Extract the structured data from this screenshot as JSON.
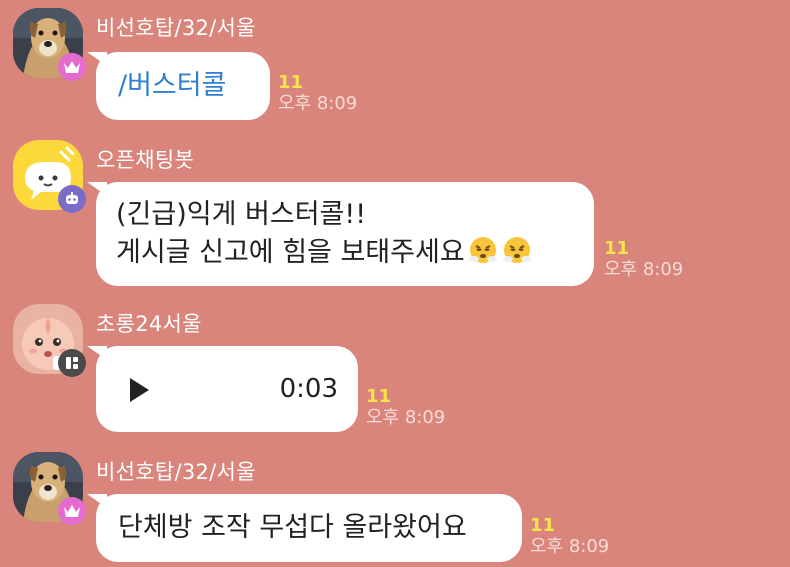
{
  "background_color": "#d9857c",
  "messages": [
    {
      "sender": "비선호탑/32/서울",
      "avatar_icon": "dog-photo-avatar",
      "badge_icon": "crown-icon",
      "text": "/버스터콜",
      "read_count": "11",
      "time": "오후 8:09"
    },
    {
      "sender": "오픈채팅봇",
      "avatar_icon": "chatbot-avatar",
      "badge_icon": "robot-icon",
      "line1": "(긴급)익게 버스터콜!!",
      "line2": "게시글 신고에 힘을 보태주세요",
      "emoji_icon": "angry-steam-face-emoji",
      "read_count": "11",
      "time": "오후 8:09"
    },
    {
      "sender": "초롱24서울",
      "avatar_icon": "peach-character-avatar",
      "badge_icon": "manager-icon",
      "duration": "0:03",
      "play_icon": "play-icon",
      "read_count": "11",
      "time": "오후 8:09"
    },
    {
      "sender": "비선호탑/32/서울",
      "avatar_icon": "dog-photo-avatar",
      "badge_icon": "crown-icon",
      "text": "단체방 조작 무섭다 올라왔어요",
      "read_count": "11",
      "time": "오후 8:09"
    }
  ]
}
